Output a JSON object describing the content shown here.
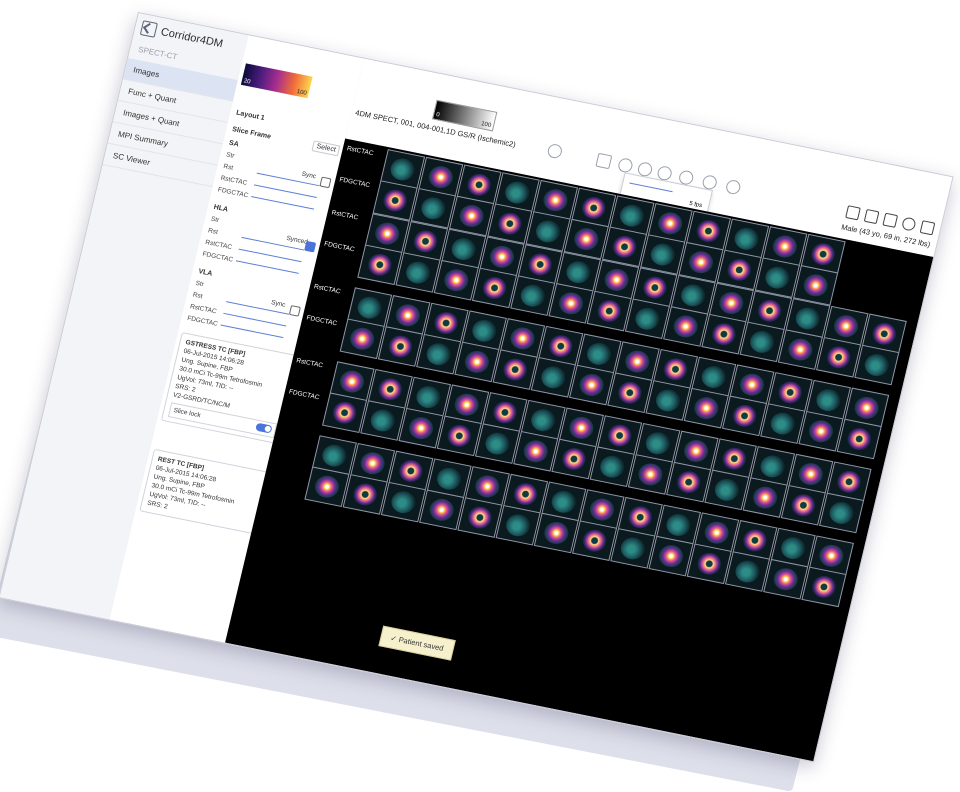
{
  "app": {
    "name": "Corridor4DM"
  },
  "sidebar": {
    "section": "SPECT-CT",
    "items": [
      {
        "label": "Images",
        "active": true
      },
      {
        "label": "Func + Quant",
        "active": false
      },
      {
        "label": "Images + Quant",
        "active": false
      },
      {
        "label": "MPI Summary",
        "active": false
      },
      {
        "label": "SC Viewer",
        "active": false
      }
    ]
  },
  "colorbar": {
    "min": "20",
    "max": "100"
  },
  "graybar": {
    "min": "0",
    "max": "100"
  },
  "study_title": "4DM SPECT, 001, 004-001,1D GS/R (Ischemic2)",
  "layout_label": "Layout 1",
  "slice_frame": {
    "label": "Slice Frame",
    "select": "Select"
  },
  "groups": [
    {
      "title": "SA",
      "rows": [
        "Str",
        "Rst",
        "RstCTAC",
        "FDGCTAC"
      ],
      "sync": "Sync"
    },
    {
      "title": "HLA",
      "rows": [
        "Str",
        "Rst",
        "RstCTAC",
        "FDGCTAC"
      ],
      "sync": "Synced"
    },
    {
      "title": "VLA",
      "rows": [
        "Str",
        "Rst",
        "RstCTAC",
        "FDGCTAC"
      ],
      "sync": "Sync"
    }
  ],
  "stress_card": {
    "title": "GSTRESS TC [FBP]",
    "lines": [
      "06-Jul-2015 14:06:28",
      "Ung. Supine, FBP",
      "30.0 mCi Tc-99m Tetrofosmin",
      "UgVol: 73ml, TID: --",
      "SRS: 2",
      "V2-GSRD/TC/NC/M"
    ],
    "slice_lock": "Slice lock"
  },
  "rest_card": {
    "title": "REST TC [FBP]",
    "lines": [
      "06-Jul-2015 14:06:28",
      "Ung. Supine, FBP",
      "30.0 mCi Tc-99m Tetrofosmin",
      "UgVol: 73ml, TID: --",
      "SRS: 2"
    ]
  },
  "playback": {
    "fps": "5 fps"
  },
  "patient": "Male (43 yo, 69 in, 272 lbs)",
  "viewer_rows": [
    {
      "label": "RstCTAC"
    },
    {
      "label": "FDGCTAC"
    },
    {
      "label": "RstCTAC"
    },
    {
      "label": "FDGCTAC"
    },
    {
      "label": "RstCTAC"
    },
    {
      "label": "FDGCTAC"
    },
    {
      "label": "RstCTAC"
    },
    {
      "label": "FDGCTAC"
    }
  ],
  "toast": "Patient saved",
  "colors": {
    "accent": "#4a74d9",
    "viewer_bg": "#000000",
    "toast_bg": "#f6f0cc"
  }
}
